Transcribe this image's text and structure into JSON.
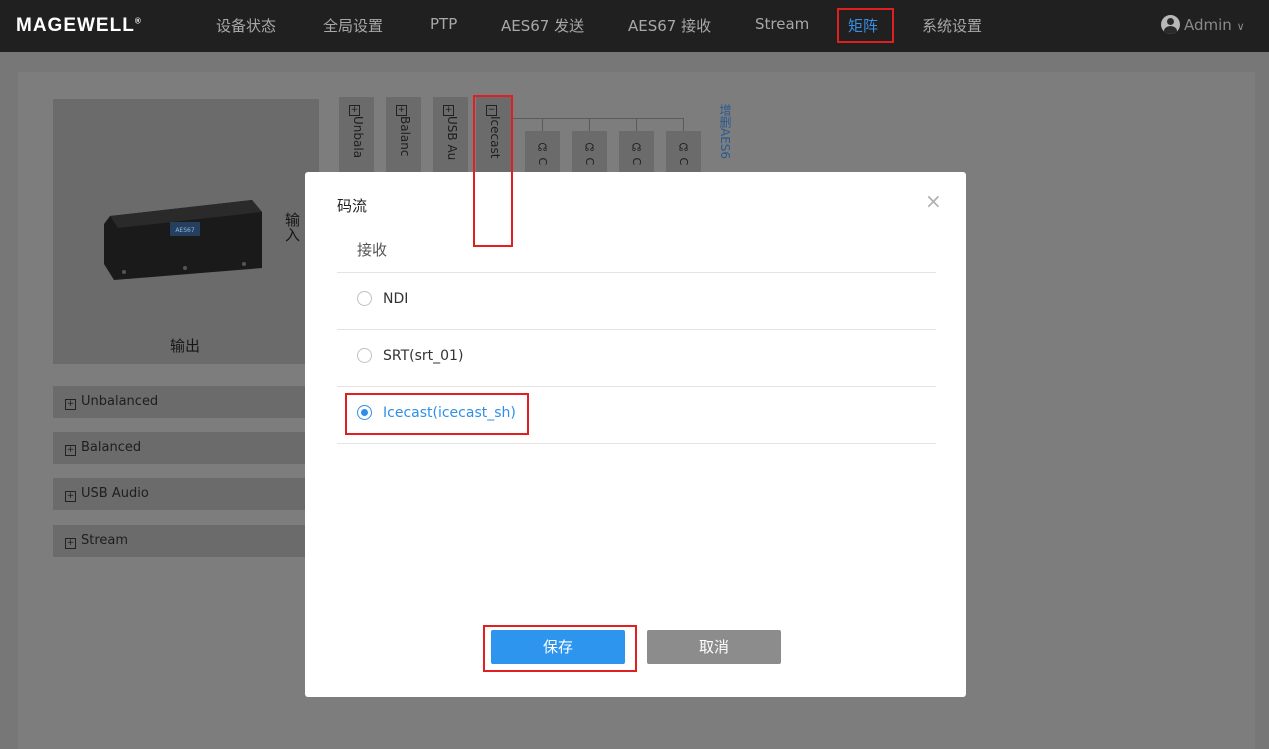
{
  "header": {
    "logo": "MAGEWELL",
    "logo_mark": "®",
    "nav": [
      "设备状态",
      "全局设置",
      "PTP",
      "AES67 发送",
      "AES67 接收",
      "Stream",
      "矩阵",
      "系统设置"
    ],
    "active_nav": "矩阵",
    "user": "Admin",
    "user_caret": "∨"
  },
  "background": {
    "output_label": "输出",
    "input_label": "输入",
    "rows": [
      "Unbalanced",
      "Balanced",
      "USB Audio",
      "Stream"
    ],
    "columns": [
      "Unbala",
      "Balanc",
      "USB Au",
      "Icecast"
    ],
    "sub_columns": [
      "C",
      "C",
      "C",
      "C"
    ],
    "add_column": "增删AES6",
    "device_caption": "AES67"
  },
  "dialog": {
    "title": "码流",
    "section": "接收",
    "options": [
      "NDI",
      "SRT(srt_01)",
      "Icecast(icecast_sh)"
    ],
    "selected_index": 2,
    "save_label": "保存",
    "cancel_label": "取消",
    "close_glyph": "×"
  },
  "colors": {
    "accent": "#2f8fe8",
    "highlight": "#e02020",
    "cancel": "#8c8c8c"
  }
}
